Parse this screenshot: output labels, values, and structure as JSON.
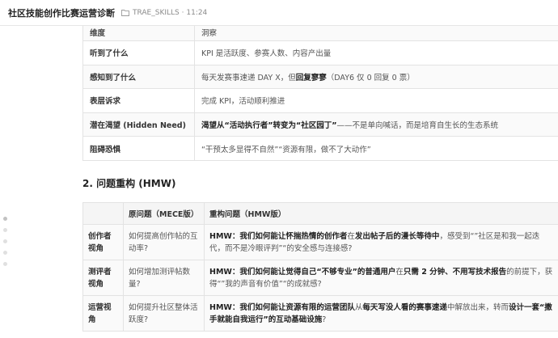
{
  "header": {
    "title": "社区技能创作比赛运营诊断",
    "folder": "TRAE_SKILLS",
    "time": "11:24"
  },
  "table1": {
    "header": {
      "k": "维度",
      "v": "洞察"
    },
    "rows": [
      {
        "k": "听到了什么",
        "v": "KPI 是活跃度、参赛人数、内容产出量"
      },
      {
        "k": "感知到了什么",
        "v_a": "每天发赛事速递 DAY X，但",
        "v_b": "回复寥寥",
        "v_c": "（DAY6 仅 0 回复 0 票）"
      },
      {
        "k": "表层诉求",
        "v": "完成 KPI，活动顺利推进"
      },
      {
        "k": "潜在渴望 (Hidden Need)",
        "v_a": "渴望从“活动执行者”转变为“社区园丁”",
        "v_c": "——不是单向喊话，而是培育自生长的生态系统"
      },
      {
        "k": "阻碍恐惧",
        "v": "“干预太多显得不自然”“资源有限，做不了大动作”"
      }
    ]
  },
  "section2": {
    "title": "2. 问题重构 (HMW)"
  },
  "table2": {
    "headers": {
      "role": "",
      "orig": "原问题（MECE版）",
      "hmw": "重构问题（HMW版）"
    },
    "rows": [
      {
        "role": "创作者视角",
        "orig": "如何提高创作帖的互动率?",
        "p1": "HMW：我们如何能让",
        "b1": "怀揣热情的创作者",
        "p2": "在",
        "b2": "发出帖子后的漫长等待中",
        "p3": "，感受到“”社区是和我一起迭代，而不是冷眼评判”“的安全感与连接感?"
      },
      {
        "role": "测评者视角",
        "orig": "如何增加测评帖数量?",
        "p1": "HMW：我们如何能让",
        "b1": "觉得自己“不够专业”的普通用户",
        "p2": "在",
        "b2": "只需 2 分钟、不用写技术报告",
        "p3": "的前提下，获得“”我的声音有价值”“的成就感?"
      },
      {
        "role": "运营视角",
        "orig": "如何提升社区整体活跃度?",
        "p1": "HMW：我们如何能让",
        "b1": "资源有限的运营团队",
        "p2": "从",
        "b2": "每天写没人看的赛事速递",
        "p3": "中解放出来，转而",
        "b3": "设计一套“撒手就能自我运行”的互动基础设施",
        "p4": "?"
      }
    ]
  },
  "dots": {
    "count": 5,
    "active_index": 0
  }
}
